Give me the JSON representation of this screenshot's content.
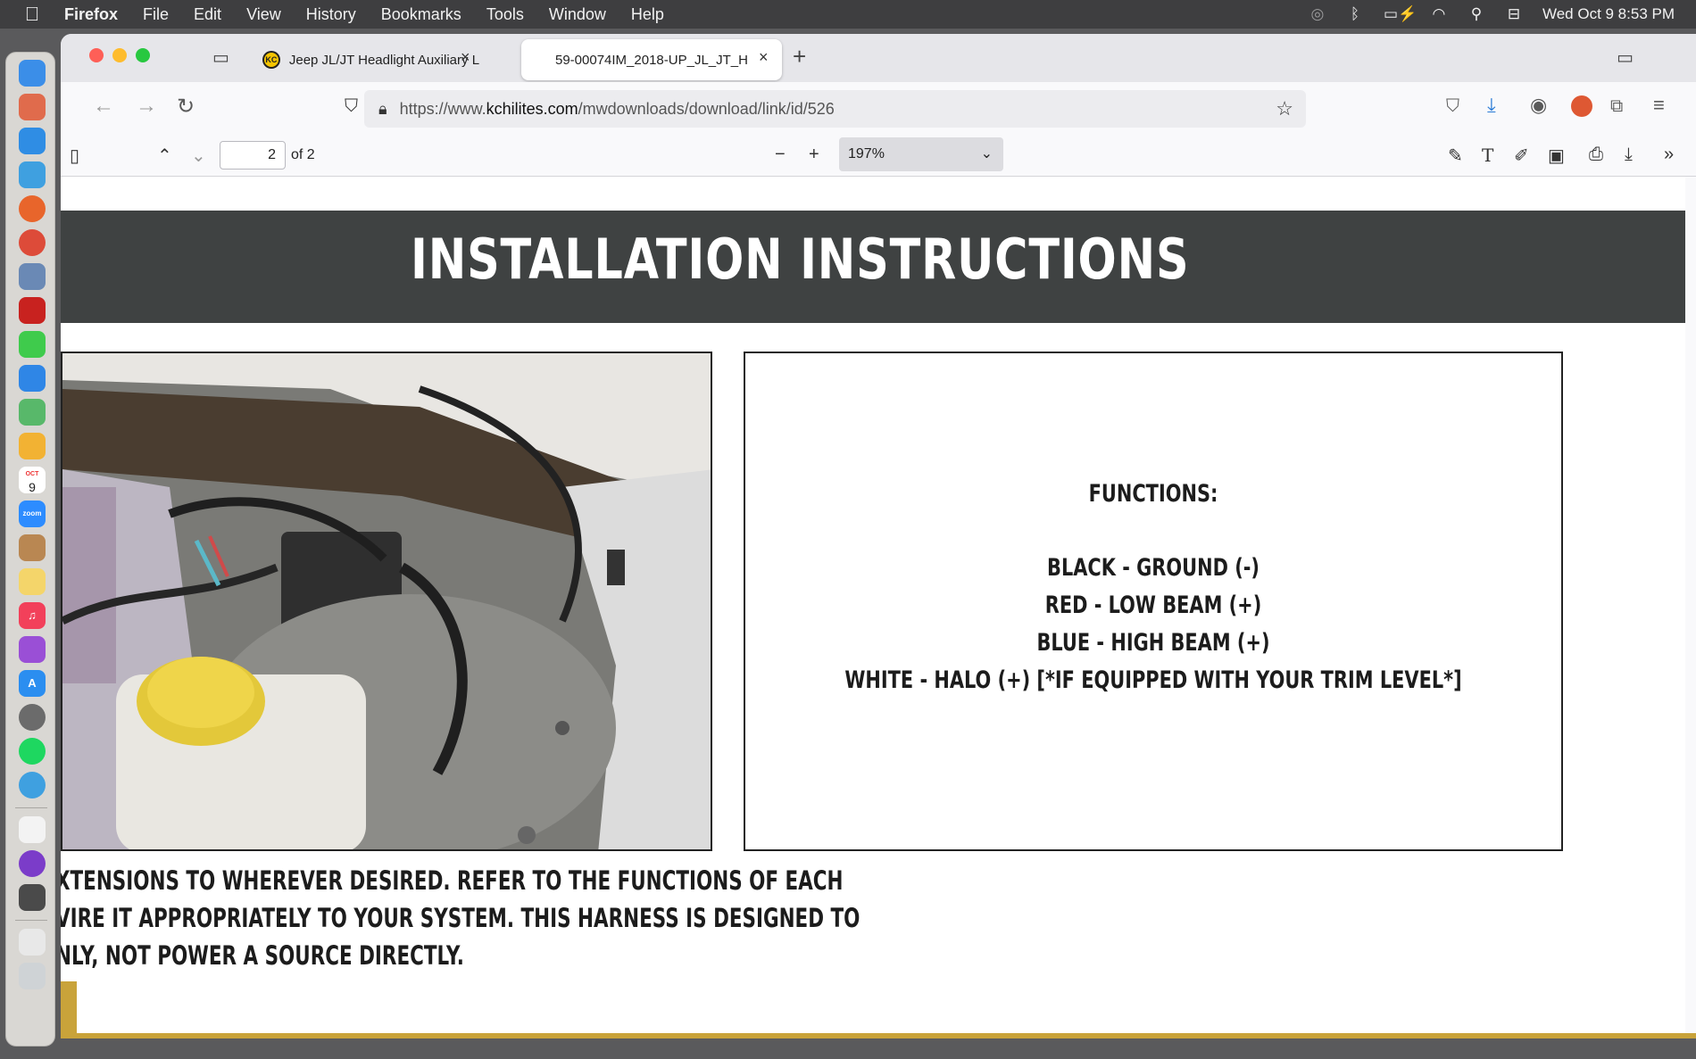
{
  "menubar": {
    "app": "Firefox",
    "items": [
      "File",
      "Edit",
      "View",
      "History",
      "Bookmarks",
      "Tools",
      "Window",
      "Help"
    ],
    "datetime": "Wed Oct 9  8:53 PM"
  },
  "dock": {
    "calendar_day": "9",
    "calendar_month": "OCT",
    "zoom_label": "zoom"
  },
  "tabs": [
    {
      "title": "Jeep JL/JT Headlight Auxiliary L",
      "favicon": "KC"
    },
    {
      "title": "59-00074IM_2018-UP_JL_JT_H"
    }
  ],
  "url": {
    "prefix": "https://www.",
    "host": "kchilites.com",
    "path": "/mwdownloads/download/link/id/526"
  },
  "pdf_toolbar": {
    "page_number": "2",
    "page_total": "of 2",
    "zoom": "197%"
  },
  "document": {
    "banner_title": "INSTALLATION INSTRUCTIONS",
    "functions": {
      "heading": "FUNCTIONS:",
      "lines": [
        "BLACK - GROUND (-)",
        "RED - LOW BEAM (+)",
        "BLUE - HIGH BEAM (+)",
        "WHITE - HALO (+) [*IF EQUIPPED WITH YOUR TRIM LEVEL*]"
      ]
    },
    "body_lines": [
      "XTENSIONS TO WHEREVER DESIRED. REFER TO THE FUNCTIONS OF EACH",
      "VIRE IT APPROPRIATELY TO YOUR SYSTEM. THIS HARNESS IS DESIGNED TO",
      "NLY, NOT POWER A SOURCE DIRECTLY."
    ]
  }
}
